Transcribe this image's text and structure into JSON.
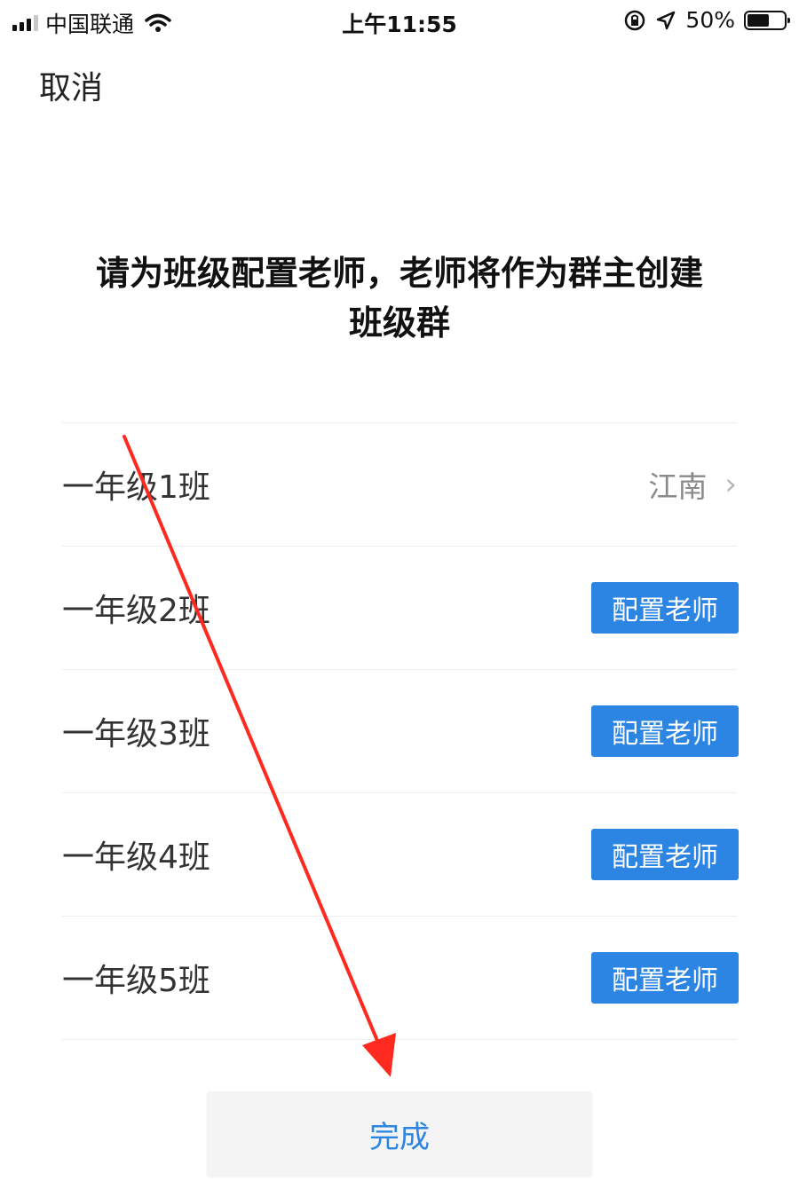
{
  "status_bar": {
    "carrier": "中国联通",
    "time": "上午11:55",
    "battery": "50%",
    "battery_level": 0.5,
    "icons": [
      "signal-icon",
      "wifi-icon",
      "orientation-lock-icon",
      "location-icon",
      "battery-icon"
    ]
  },
  "nav": {
    "cancel_label": "取消"
  },
  "headline": {
    "line1": "请为班级配置老师，老师将作为群主创建",
    "line2": "班级群"
  },
  "classes": [
    {
      "name": "一年级1班",
      "teacher": "江南"
    },
    {
      "name": "一年级2班",
      "action": "配置老师"
    },
    {
      "name": "一年级3班",
      "action": "配置老师"
    },
    {
      "name": "一年级4班",
      "action": "配置老师"
    },
    {
      "name": "一年级5班",
      "action": "配置老师"
    }
  ],
  "footer": {
    "done_label": "完成"
  },
  "colors": {
    "accent": "#2c85e3",
    "annotation": "#ff2a1f",
    "done_bg": "#f4f4f4"
  }
}
